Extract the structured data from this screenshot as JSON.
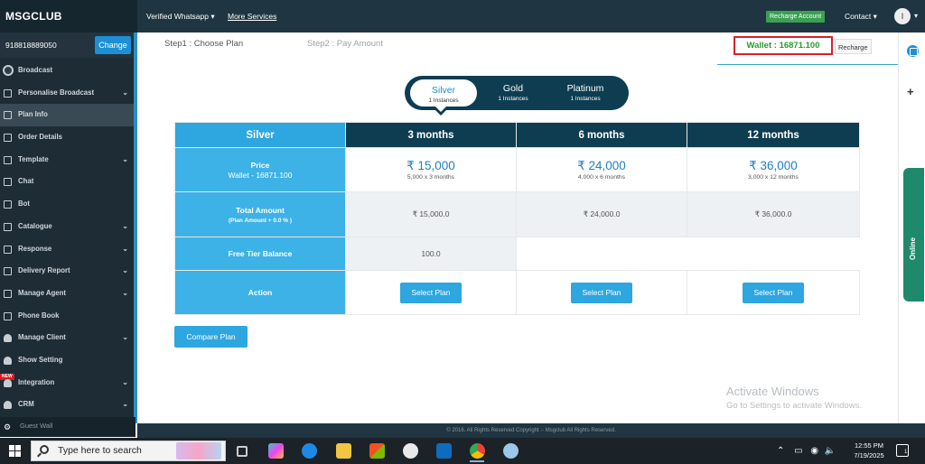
{
  "topbar": {
    "brand": "MSGCLUB",
    "nav_verified": "Verified Whatsapp ▾",
    "nav_more": "More Services",
    "recharge_account": "Recharge Account",
    "contact": "Contact ▾",
    "avatar_letter": "I"
  },
  "sidebar": {
    "account_number": "918818889050",
    "change_label": "Change",
    "items": [
      {
        "label": "Broadcast",
        "caret": ""
      },
      {
        "label": "Personalise Broadcast",
        "caret": "⌄"
      },
      {
        "label": "Plan Info",
        "caret": ""
      },
      {
        "label": "Order Details",
        "caret": ""
      },
      {
        "label": "Template",
        "caret": "⌄"
      },
      {
        "label": "Chat",
        "caret": ""
      },
      {
        "label": "Bot",
        "caret": ""
      },
      {
        "label": "Catalogue",
        "caret": "⌄"
      },
      {
        "label": "Response",
        "caret": "⌄"
      },
      {
        "label": "Delivery Report",
        "caret": "⌄"
      },
      {
        "label": "Manage Agent",
        "caret": "⌄"
      },
      {
        "label": "Phone Book",
        "caret": ""
      },
      {
        "label": "Manage Client",
        "caret": "⌄"
      },
      {
        "label": "Show Setting",
        "caret": ""
      },
      {
        "label": "Integration",
        "caret": "⌄",
        "badge": "NEW"
      },
      {
        "label": "CRM",
        "caret": "⌄"
      }
    ],
    "bottom_label": "Guest Wall"
  },
  "steps": {
    "step1": "Step1 : Choose Plan",
    "step2": "Step2 : Pay Amount"
  },
  "wallet": {
    "label": "Wallet : 16871.100",
    "recharge": "Recharge"
  },
  "plan_tabs": [
    {
      "name": "Silver",
      "instances": "1 Instances"
    },
    {
      "name": "Gold",
      "instances": "1 Instances"
    },
    {
      "name": "Platinum",
      "instances": "1 Instances"
    }
  ],
  "table": {
    "selected_plan": "Silver",
    "columns": [
      "3 months",
      "6 months",
      "12 months"
    ],
    "price_label": "Price",
    "price_wallet": "Wallet - 16871.100",
    "prices": [
      {
        "amount": "₹ 15,000",
        "detail": "5,000 x 3 months"
      },
      {
        "amount": "₹ 24,000",
        "detail": "4,000 x 6 months"
      },
      {
        "amount": "₹ 36,000",
        "detail": "3,000 x 12 months"
      }
    ],
    "total_label": "Total Amount",
    "total_sub": "(Plan Amount + 0.0 % )",
    "totals": [
      "₹ 15,000.0",
      "₹ 24,000.0",
      "₹ 36,000.0"
    ],
    "free_tier_label": "Free Tier Balance",
    "free_tier_value": "100.0",
    "action_label": "Action",
    "select_button": "Select Plan"
  },
  "compare_button": "Compare Plan",
  "activate_windows": {
    "title": "Activate Windows",
    "subtitle": "Go to Settings to activate Windows."
  },
  "right_panel": {
    "online_label": "Online"
  },
  "footer": "© 2016. All Rights Reserved Copyright :- Msgclub All Rights Reserved.",
  "taskbar": {
    "search_placeholder": "Type here to search",
    "time": "12:55 PM",
    "date": "7/19/2025",
    "notification_count": "1"
  }
}
